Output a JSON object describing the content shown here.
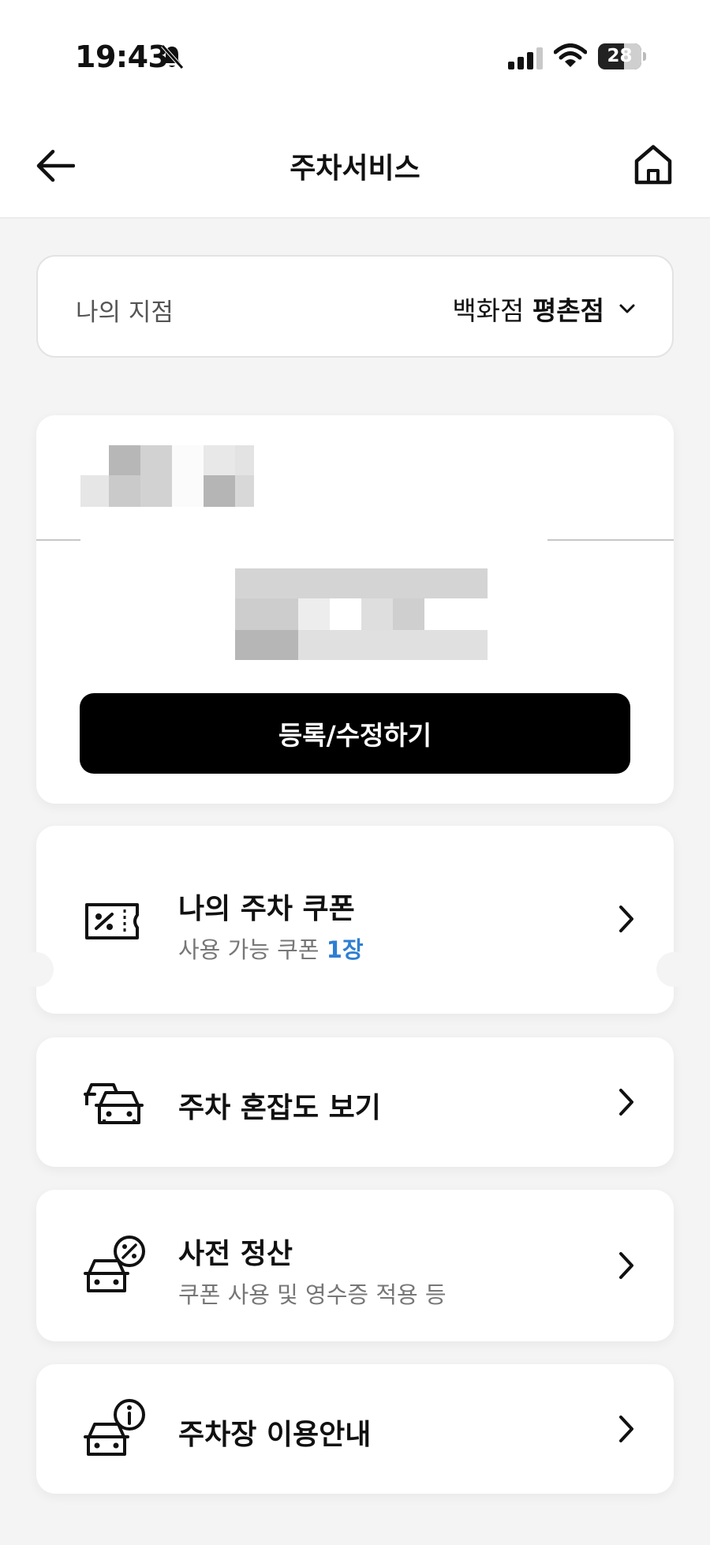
{
  "status": {
    "time": "19:43",
    "battery": "28"
  },
  "header": {
    "title": "주차서비스"
  },
  "branch": {
    "label": "나의 지점",
    "value_prefix": "백화점",
    "value_bold": "평촌점"
  },
  "vehicle": {
    "register_label": "등록/수정하기"
  },
  "menu": {
    "coupon": {
      "title": "나의 주차 쿠폰",
      "sub_prefix": "사용 가능 쿠폰",
      "sub_count": "1장"
    },
    "congestion": {
      "title": "주차 혼잡도 보기"
    },
    "prepay": {
      "title": "사전 정산",
      "sub": "쿠폰 사용 및 영수증 적용 등"
    },
    "guide": {
      "title": "주차장 이용안내"
    }
  },
  "icons": {
    "back": "arrow-left-icon",
    "home": "home-icon",
    "coupon": "coupon-ticket-icon",
    "congestion": "cars-icon",
    "prepay": "car-discount-icon",
    "guide": "car-info-icon"
  },
  "colors": {
    "accent": "#2e7fd1",
    "button": "#000000",
    "background": "#f4f4f4"
  }
}
